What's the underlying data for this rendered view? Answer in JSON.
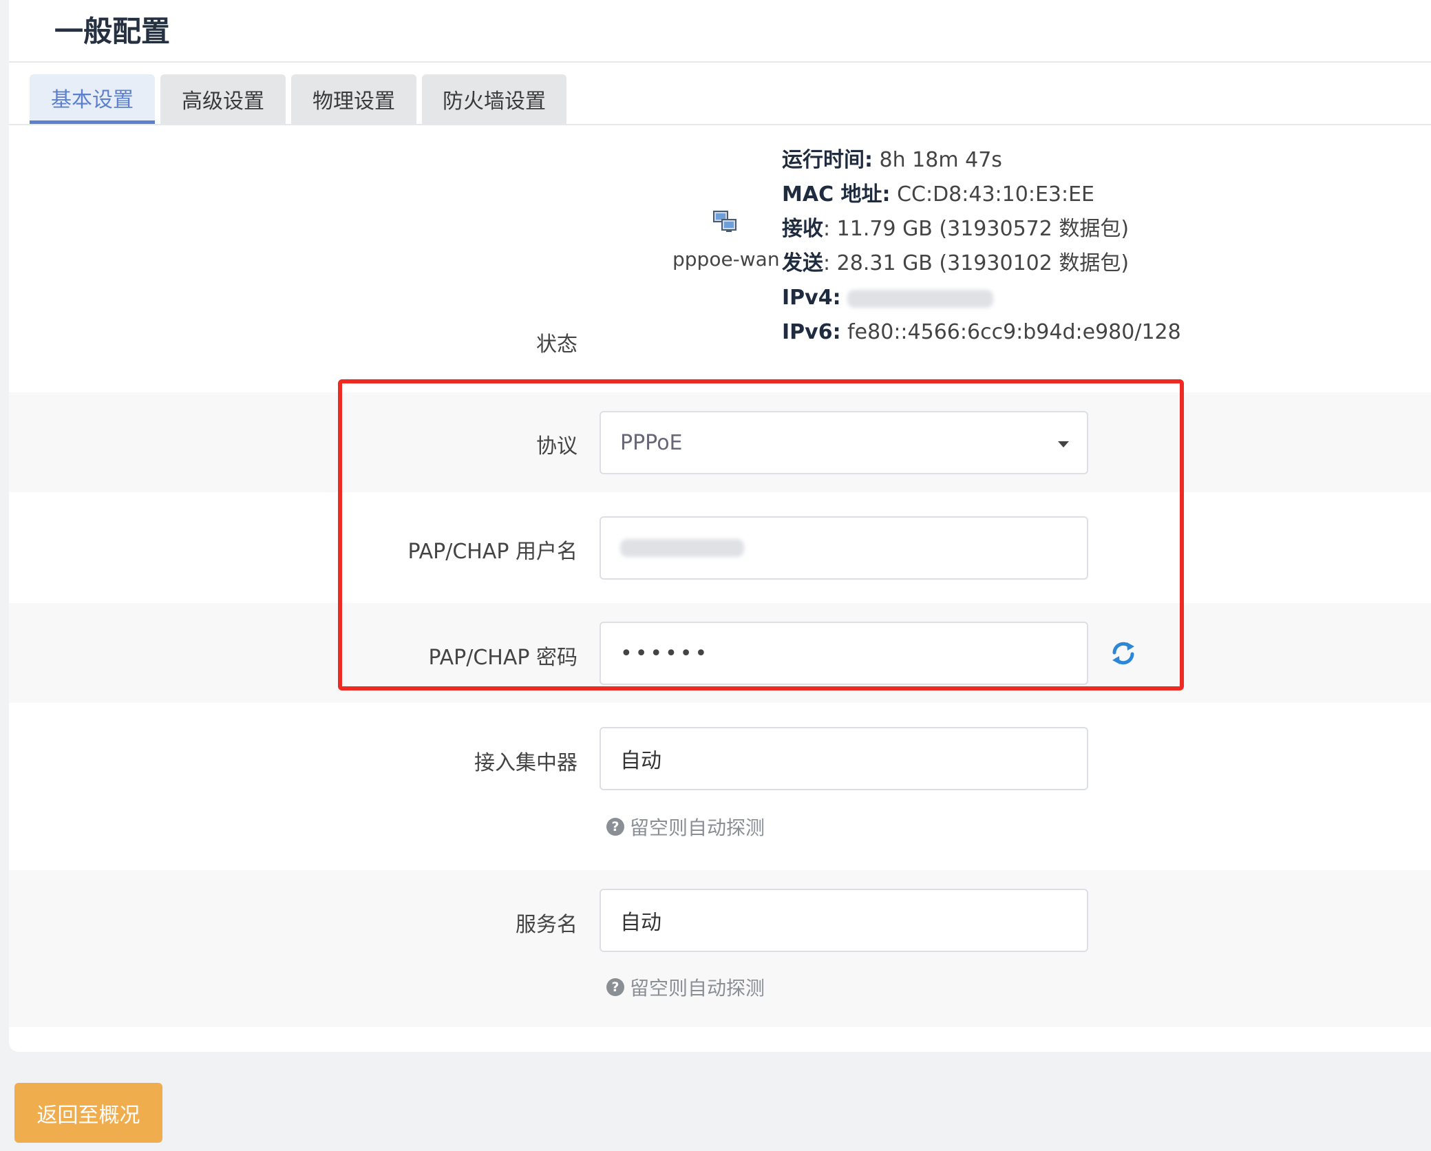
{
  "page": {
    "title": "一般配置"
  },
  "tabs": [
    {
      "label": "基本设置",
      "active": true
    },
    {
      "label": "高级设置",
      "active": false
    },
    {
      "label": "物理设置",
      "active": false
    },
    {
      "label": "防火墙设置",
      "active": false
    }
  ],
  "status": {
    "label": "状态",
    "interface_name": "pppoe-wan",
    "interface_icon": "network-interface-icon",
    "uptime_label": "运行时间:",
    "uptime_value": "8h 18m 47s",
    "mac_label": "MAC 地址:",
    "mac_value": "CC:D8:43:10:E3:EE",
    "rx_label": "接收",
    "rx_value": ": 11.79 GB (31930572 数据包)",
    "tx_label": "发送",
    "tx_value": ": 28.31 GB (31930102 数据包)",
    "ipv4_label": "IPv4:",
    "ipv6_label": "IPv6:",
    "ipv6_value": "fe80::4566:6cc9:b94d:e980/128"
  },
  "form": {
    "protocol_label": "协议",
    "protocol_value": "PPPoE",
    "username_label": "PAP/CHAP 用户名",
    "password_label": "PAP/CHAP 密码",
    "password_value": "••••••",
    "concentrator_label": "接入集中器",
    "concentrator_placeholder": "自动",
    "concentrator_hint": "留空则自动探测",
    "service_label": "服务名",
    "service_placeholder": "自动",
    "service_hint": "留空则自动探测"
  },
  "back_button": "返回至概况",
  "colors": {
    "accent": "#5a80cf",
    "highlight": "#ee2a22",
    "button": "#f0ad4e"
  }
}
